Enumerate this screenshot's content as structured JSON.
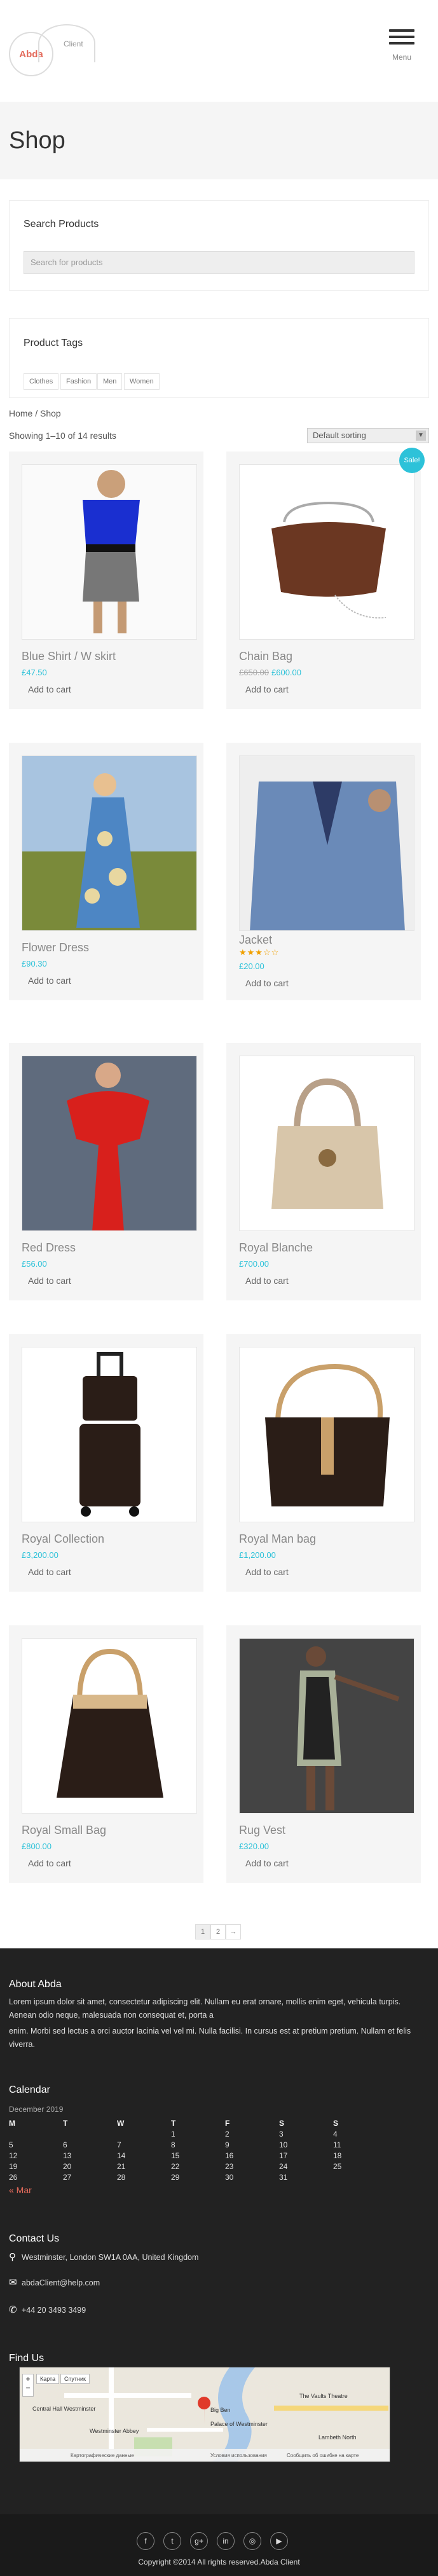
{
  "header": {
    "logo_text": "Abda",
    "logo_sub": "Client",
    "menu_label": "Menu"
  },
  "page_title": "Shop",
  "search_widget": {
    "title": "Search Products",
    "placeholder": "Search for products"
  },
  "tags_widget": {
    "title": "Product Tags",
    "tags": [
      "Clothes",
      "Fashion",
      "Men",
      "Women"
    ]
  },
  "breadcrumb": "Home / Shop",
  "result_count": "Showing 1–10 of 14 results",
  "sort": {
    "selected": "Default sorting"
  },
  "sale_badge": "Sale!",
  "add_label": "Add to cart",
  "products": [
    {
      "name": "Blue Shirt / W skirt",
      "price": "£47.50",
      "old_price": "",
      "rating": null
    },
    {
      "name": "Chain Bag",
      "price": "£600.00",
      "old_price": "£650.00",
      "rating": null
    },
    {
      "name": "Flower Dress",
      "price": "£90.30",
      "old_price": "",
      "rating": null
    },
    {
      "name": "Jacket",
      "price": "£20.00",
      "old_price": "",
      "rating": 3
    },
    {
      "name": "Red Dress",
      "price": "£56.00",
      "old_price": "",
      "rating": null
    },
    {
      "name": "Royal Blanche",
      "price": "£700.00",
      "old_price": "",
      "rating": null
    },
    {
      "name": "Royal Collection",
      "price": "£3,200.00",
      "old_price": "",
      "rating": null
    },
    {
      "name": "Royal Man bag",
      "price": "£1,200.00",
      "old_price": "",
      "rating": null
    },
    {
      "name": "Royal Small Bag",
      "price": "£800.00",
      "old_price": "",
      "rating": null
    },
    {
      "name": "Rug Vest",
      "price": "£320.00",
      "old_price": "",
      "rating": null
    }
  ],
  "pagination": [
    "1",
    "2",
    "→"
  ],
  "footer": {
    "about_title": "About Abda",
    "about_p1": "Lorem ipsum dolor sit amet, consectetur adipiscing elit. Nullam eu erat ornare, mollis enim eget, vehicula turpis. Aenean odio neque, malesuada non consequat et, porta a",
    "about_p2": "enim. Morbi sed lectus a orci auctor lacinia vel vel mi. Nulla facilisi. In cursus est at pretium pretium. Nullam et felis viverra.",
    "calendar_title": "Calendar",
    "calendar_caption": "December 2019",
    "calendar_head": [
      "M",
      "T",
      "W",
      "T",
      "F",
      "S",
      "S"
    ],
    "calendar_rows": [
      [
        "",
        "",
        "",
        "1",
        "2",
        "3",
        "4"
      ],
      [
        "5",
        "6",
        "7",
        "8",
        "9",
        "10",
        "11"
      ],
      [
        "12",
        "13",
        "14",
        "15",
        "16",
        "17",
        "18"
      ],
      [
        "19",
        "20",
        "21",
        "22",
        "23",
        "24",
        "25"
      ],
      [
        "26",
        "27",
        "28",
        "29",
        "30",
        "31",
        ""
      ]
    ],
    "calendar_prev": "« Mar",
    "contact_title": "Contact Us",
    "address": "Westminster, London SW1A 0AA, United Kingdom",
    "email": "abdaClient@help.com",
    "phone": "+44 20 3493 3499",
    "find_title": "Find Us",
    "map_labels": [
      "Карта",
      "Спутник",
      "Palace of Westminster",
      "Central Hall Westminster",
      "Westminster Abbey",
      "The Vaults Theatre",
      "Big Ben",
      "Lambeth North",
      "Картографические данные",
      "Условия использования",
      "Сообщить об ошибке на карте"
    ],
    "social": [
      "f",
      "t",
      "g+",
      "in",
      "◎",
      "▶"
    ],
    "copyright": "Copyright ©2014 All rights reserved.Abda Client"
  },
  "colors": {
    "accent": "#2dc2d9",
    "logo": "#e36a5b",
    "footer_bg": "#222222"
  }
}
